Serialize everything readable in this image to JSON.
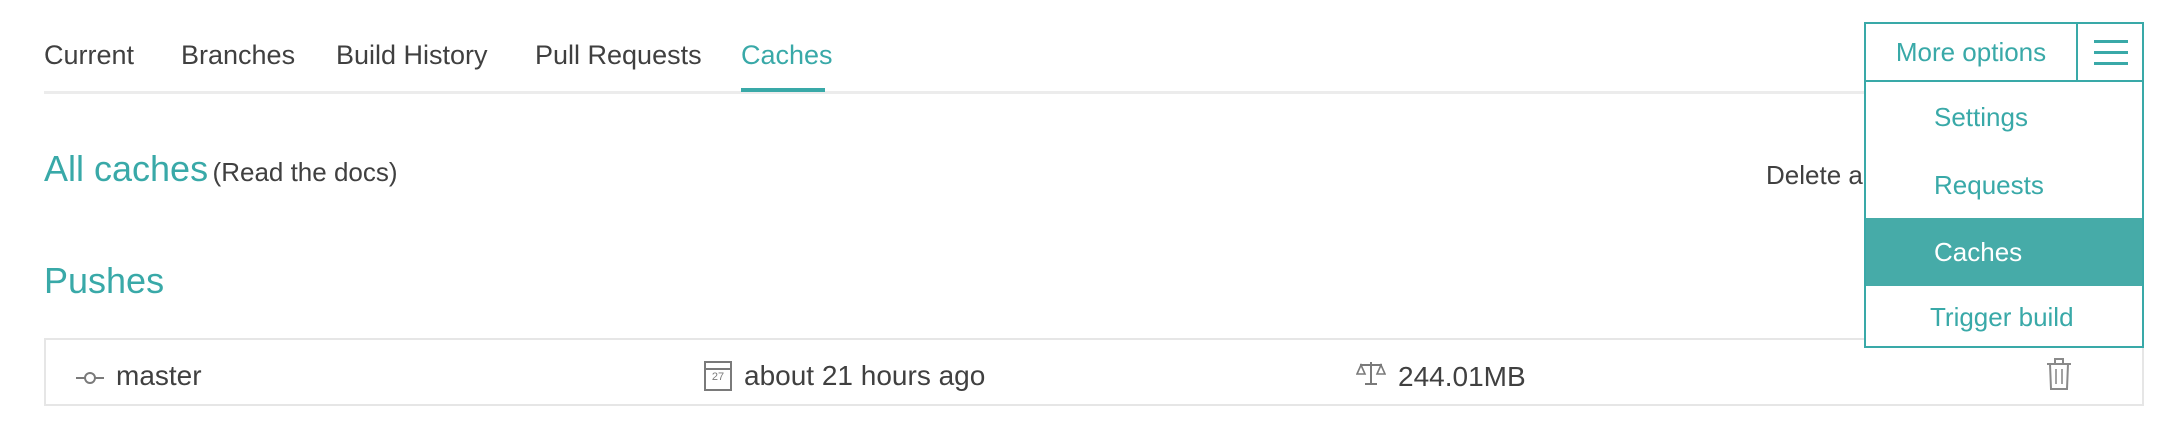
{
  "tabs": [
    {
      "label": "Current",
      "active": false
    },
    {
      "label": "Branches",
      "active": false
    },
    {
      "label": "Build History",
      "active": false
    },
    {
      "label": "Pull Requests",
      "active": false
    },
    {
      "label": "Caches",
      "active": true
    }
  ],
  "heading": {
    "title": "All caches",
    "docs_open": "(",
    "docs_link": "Read the docs",
    "docs_close": ")",
    "delete_all": "Delete all"
  },
  "section": {
    "title": "Pushes"
  },
  "cache": {
    "branch": "master",
    "calendar_day": "27",
    "time": "about 21 hours ago",
    "size": "244.01MB"
  },
  "menu": {
    "more_options": "More options",
    "items": [
      {
        "label": "Settings",
        "active": false
      },
      {
        "label": "Requests",
        "active": false
      },
      {
        "label": "Caches",
        "active": true
      },
      {
        "label": "Trigger build",
        "active": false
      }
    ]
  },
  "colors": {
    "accent": "#39a9a8",
    "active_menu_bg": "#46aba8",
    "text": "#404040",
    "border": "#e6e6e6"
  },
  "icons": {
    "branch": "commit-branch-icon",
    "calendar": "calendar-icon",
    "size": "scale-icon",
    "delete": "trash-icon",
    "menu": "hamburger-icon"
  }
}
